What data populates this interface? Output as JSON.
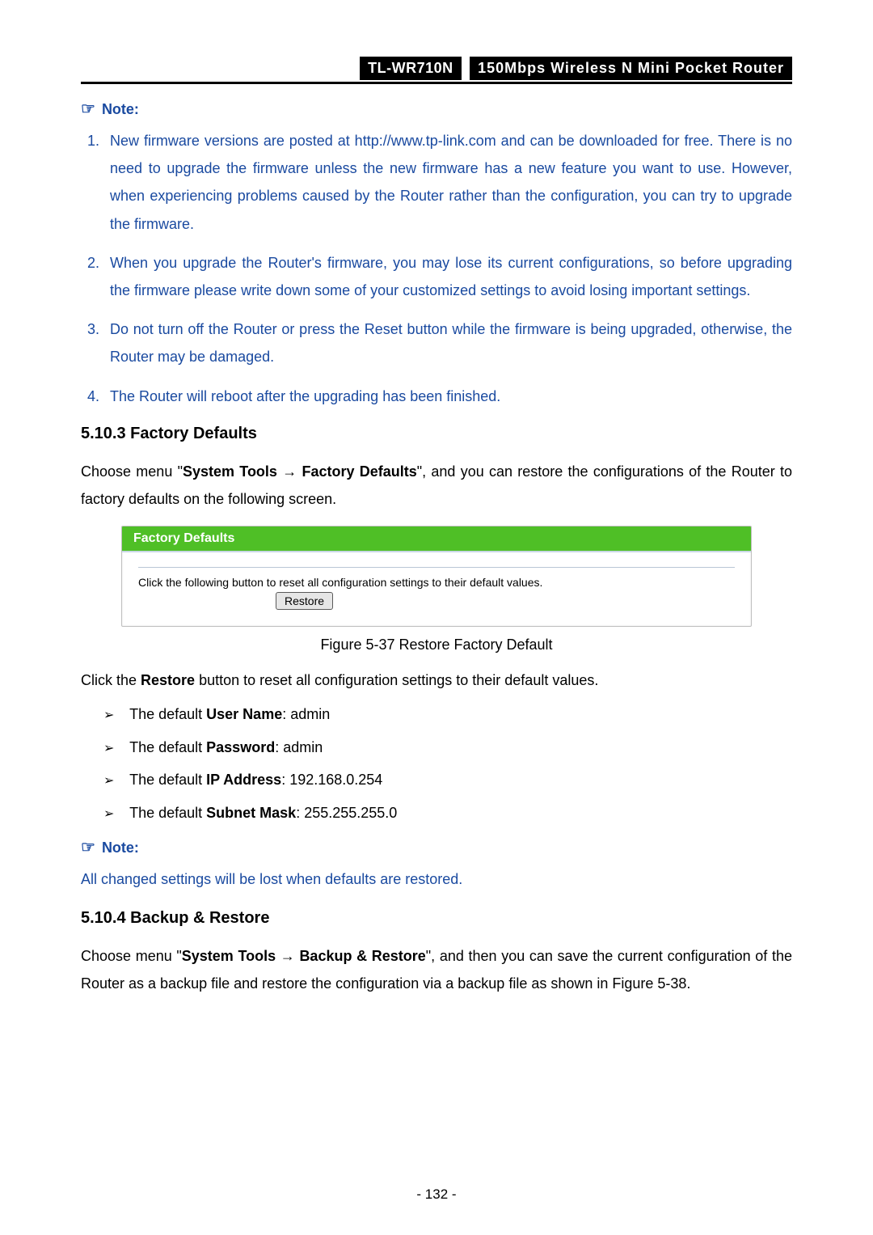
{
  "header": {
    "model": "TL-WR710N",
    "description": "150Mbps Wireless N Mini Pocket Router"
  },
  "note1": {
    "label": "Note:",
    "items": [
      "New firmware versions are posted at http://www.tp-link.com and can be downloaded for free. There is no need to upgrade the firmware unless the new firmware has a new feature you want to use. However, when experiencing problems caused by the Router rather than the configuration, you can try to upgrade the firmware.",
      "When you upgrade the Router's firmware, you may lose its current configurations, so before upgrading the firmware please write down some of your customized settings to avoid losing important settings.",
      "Do not turn off the Router or press the Reset button while the firmware is being upgraded, otherwise, the Router may be damaged.",
      "The Router will reboot after the upgrading has been finished."
    ]
  },
  "section1": {
    "heading": "5.10.3 Factory Defaults",
    "intro_pre": "Choose menu \"",
    "intro_bold1": "System Tools",
    "intro_arrow": " → ",
    "intro_bold2": "Factory Defaults",
    "intro_post": "\", and you can restore the configurations of the Router to factory defaults on the following screen.",
    "figure": {
      "title": "Factory Defaults",
      "body_text": "Click the following button to reset all configuration settings to their default values.",
      "button_label": "Restore",
      "caption": "Figure 5-37 Restore Factory Default"
    },
    "after_pre": "Click the ",
    "after_bold": "Restore",
    "after_post": " button to reset all configuration settings to their default values.",
    "defaults": [
      {
        "pre": "The default ",
        "bold": "User Name",
        "post": ": admin"
      },
      {
        "pre": "The default ",
        "bold": "Password",
        "post": ": admin"
      },
      {
        "pre": "The default ",
        "bold": "IP Address",
        "post": ": 192.168.0.254"
      },
      {
        "pre": "The default ",
        "bold": "Subnet Mask",
        "post": ": 255.255.255.0"
      }
    ]
  },
  "note2": {
    "label": "Note:",
    "body": "All changed settings will be lost when defaults are restored."
  },
  "section2": {
    "heading": "5.10.4 Backup & Restore",
    "intro_pre": "Choose menu \"",
    "intro_bold1": "System Tools",
    "intro_arrow": " → ",
    "intro_bold2": "Backup & Restore",
    "intro_post": "\", and then you can save the current configuration of the Router as a backup file and restore the configuration via a backup file as shown in Figure 5-38."
  },
  "page_number": "- 132 -"
}
